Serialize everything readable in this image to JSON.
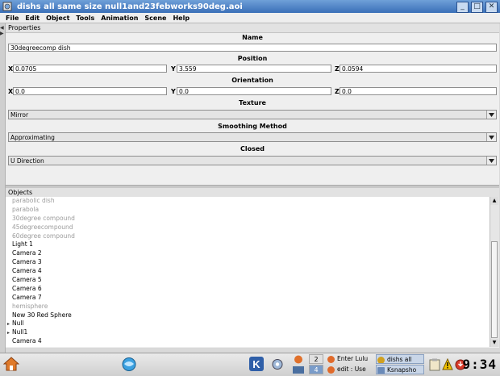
{
  "window": {
    "title": "dishs all same size null1and23febworks90deg.aoi"
  },
  "menubar": {
    "items": [
      "File",
      "Edit",
      "Object",
      "Tools",
      "Animation",
      "Scene",
      "Help"
    ]
  },
  "properties": {
    "header": "Properties",
    "name_label": "Name",
    "name_value": "30degreecomp dish",
    "position_label": "Position",
    "position": {
      "x_label": "X",
      "x": "0.0705",
      "y_label": "Y",
      "y": "3.559",
      "z_label": "Z",
      "z": "0.0594"
    },
    "orientation_label": "Orientation",
    "orientation": {
      "x_label": "X",
      "x": "0.0",
      "y_label": "Y",
      "y": "0.0",
      "z_label": "Z",
      "z": "0.0"
    },
    "texture_label": "Texture",
    "texture_value": "Mirror",
    "smoothing_label": "Smoothing Method",
    "smoothing_value": "Approximating",
    "closed_label": "Closed",
    "closed_value": "U Direction"
  },
  "objects": {
    "header": "Objects",
    "items": [
      {
        "label": "parabolic dish",
        "dim": true,
        "expander": false
      },
      {
        "label": "parabola",
        "dim": true,
        "expander": false
      },
      {
        "label": "30degree compound",
        "dim": true,
        "expander": false
      },
      {
        "label": "45degreecompound",
        "dim": true,
        "expander": false
      },
      {
        "label": "60degree compound",
        "dim": true,
        "expander": false
      },
      {
        "label": "Light 1",
        "dim": false,
        "expander": false
      },
      {
        "label": "Camera 2",
        "dim": false,
        "expander": false
      },
      {
        "label": "Camera 3",
        "dim": false,
        "expander": false
      },
      {
        "label": "Camera 4",
        "dim": false,
        "expander": false
      },
      {
        "label": "Camera 5",
        "dim": false,
        "expander": false
      },
      {
        "label": "Camera 6",
        "dim": false,
        "expander": false
      },
      {
        "label": "Camera 7",
        "dim": false,
        "expander": false
      },
      {
        "label": "hemisphere",
        "dim": true,
        "expander": false
      },
      {
        "label": "New 30 Red Sphere",
        "dim": false,
        "expander": false
      },
      {
        "label": "Null",
        "dim": false,
        "expander": true
      },
      {
        "label": "Null1",
        "dim": false,
        "expander": true
      },
      {
        "label": "Camera 4",
        "dim": false,
        "expander": false
      }
    ]
  },
  "taskbar": {
    "pager": [
      "2",
      "4"
    ],
    "tasks": [
      {
        "label": "Enter Lulu",
        "active": false
      },
      {
        "label": "dishs all",
        "active": true
      },
      {
        "label": "edit : Use",
        "active": false
      },
      {
        "label": "Ksnapsho",
        "active": true
      }
    ],
    "clock": "9:34",
    "colors": {
      "accent": "#3a6fb8",
      "active_task": "#c9d6e8"
    }
  }
}
